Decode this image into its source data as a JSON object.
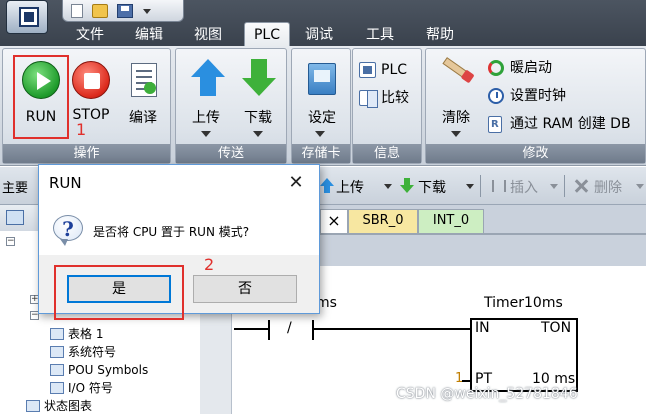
{
  "menu": {
    "tabs": [
      "文件",
      "编辑",
      "视图",
      "PLC",
      "调试",
      "工具",
      "帮助"
    ],
    "active_tab": "PLC"
  },
  "ribbon": {
    "groups": {
      "operate": "操作",
      "transfer": "传送",
      "memcard": "存储卡",
      "info": "信息",
      "modify": "修改"
    },
    "buttons": {
      "run": "RUN",
      "stop": "STOP",
      "compile": "编译",
      "upload": "上传",
      "download": "下载",
      "settings": "设定",
      "plc_info": "PLC",
      "compare": "比较",
      "clear": "清除",
      "warm_start": "暖启动",
      "set_time": "设置时钟",
      "create_db": "通过 RAM 创建 DB"
    }
  },
  "toolbar": {
    "main_label": "主要",
    "upload": "上传",
    "download": "下载",
    "insert": "插入",
    "delete": "删除"
  },
  "tree": {
    "items": [
      "表格 1",
      "系统符号",
      "POU Symbols",
      "I/O 符号",
      "状态图表"
    ]
  },
  "editor": {
    "tabs": {
      "close_glyph": "×",
      "sbr": "SBR_0",
      "int": "INT_0"
    },
    "contact_label_fragment": "ms",
    "contact_slash": "/",
    "timer": {
      "name": "Timer10ms",
      "in": "IN",
      "type": "TON",
      "pt": "PT",
      "unit": "10 ms",
      "pt_value": "1"
    }
  },
  "dialog": {
    "title": "RUN",
    "close_glyph": "✕",
    "icon_glyph": "?",
    "message": "是否将 CPU 置于 RUN 模式?",
    "yes": "是",
    "no": "否"
  },
  "annotations": [
    "1",
    "2"
  ],
  "watermark": "CSDN @weixin_52781846",
  "colors": {
    "annotation_red": "#e0302c",
    "run_green": "#1e9b2b",
    "stop_red": "#dc2a1c",
    "sbr_tab": "#f7e7a1",
    "int_tab": "#cdeec2",
    "dialog_border": "#5f9ad9"
  }
}
